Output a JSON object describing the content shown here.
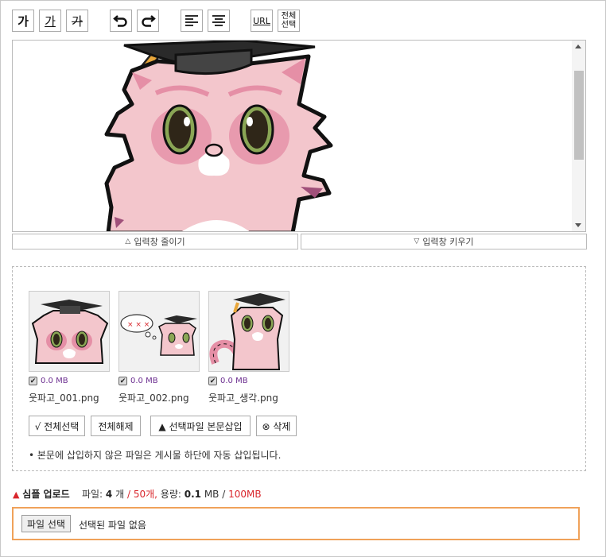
{
  "toolbar": {
    "bold": "가",
    "underline": "가",
    "strike": "가",
    "url": "URL",
    "select_all_line1": "전체",
    "select_all_line2": "선택"
  },
  "editor_resize": {
    "shrink": "입력창 줄이기",
    "grow": "입력창 키우기"
  },
  "files": [
    {
      "name": "웃파고_001.png",
      "size": "0.0 MB"
    },
    {
      "name": "웃파고_002.png",
      "size": "0.0 MB"
    },
    {
      "name": "웃파고_생각.png",
      "size": "0.0 MB"
    }
  ],
  "thumb2_marks": "× × ×",
  "actions": {
    "select_all": "√ 전체선택",
    "deselect_all": "전체해제",
    "insert": "▲ 선택파일 본문삽입",
    "delete": "⊗ 삭제"
  },
  "note": "• 본문에 삽입하지 않은 파일은 게시물 하단에 자동 삽입됩니다.",
  "upload": {
    "title": "심플 업로드",
    "files_label": "파일:",
    "count": "4",
    "count_unit": "개",
    "max_count": "/ 50개,",
    "size_label": "용량:",
    "size": "0.1",
    "size_unit": "MB",
    "max_size_sep": "/",
    "max_size": "100MB",
    "choose_button": "파일 선택",
    "no_file": "선택된 파일 없음"
  },
  "colors": {
    "accent_red": "#d9262c",
    "file_size_purple": "#6b2d8f",
    "upload_border": "#f0a25a",
    "character_pink": "#f3c6cc",
    "cheek_pink": "#e58fa6",
    "eye_green": "#8aa655"
  },
  "icons": [
    "bold-icon",
    "underline-icon",
    "strike-icon",
    "undo-icon",
    "redo-icon",
    "align-left-icon",
    "align-center-icon",
    "url-icon",
    "select-all-icon"
  ]
}
